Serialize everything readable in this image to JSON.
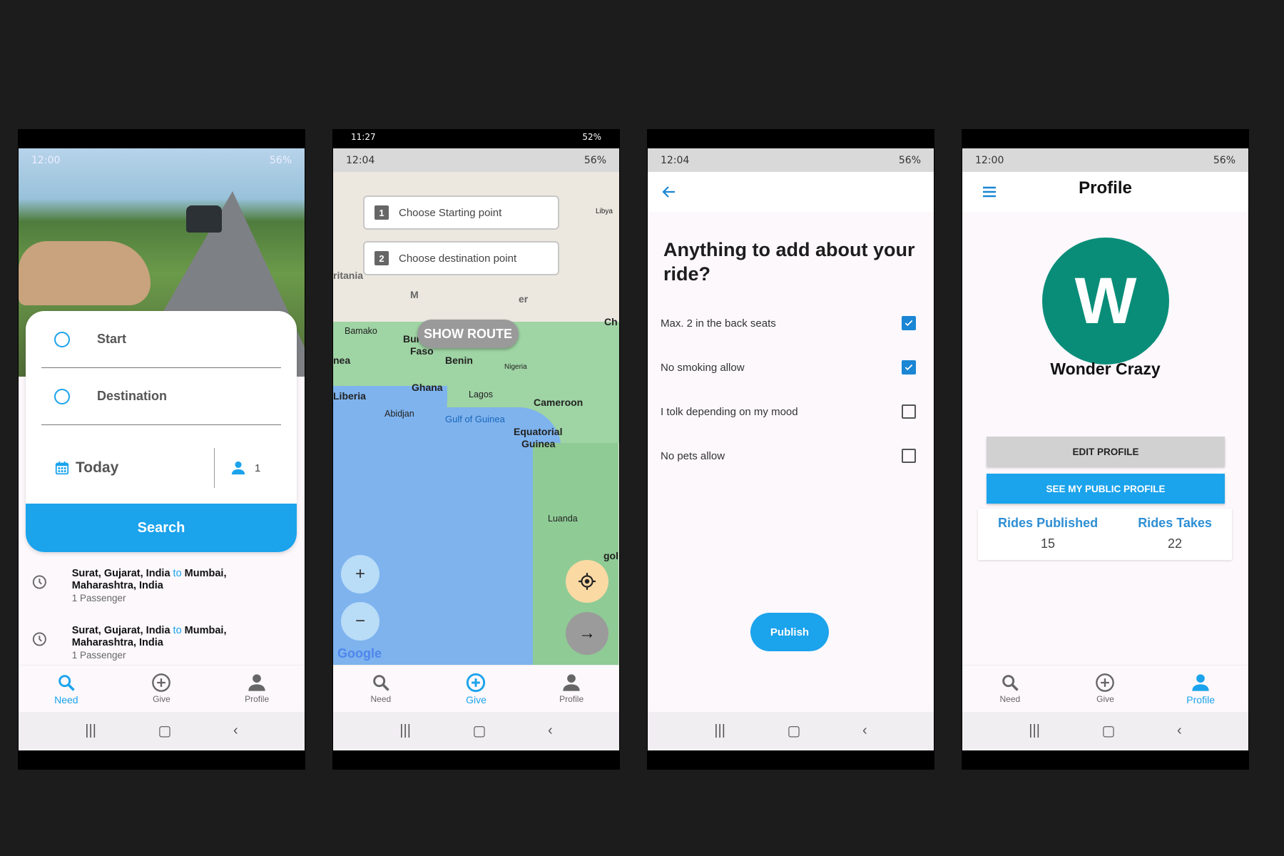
{
  "phone1": {
    "status_time": "12:00",
    "status_right": "56%",
    "start_label": "Start",
    "destination_label": "Destination",
    "date_label": "Today",
    "passenger_count": "1",
    "search_label": "Search",
    "recent": [
      {
        "from": "Surat, Gujarat, India",
        "to_word": "to",
        "to": "Mumbai, Maharashtra, India",
        "passengers": "1 Passenger"
      },
      {
        "from": "Surat, Gujarat, India",
        "to_word": "to",
        "to": "Mumbai, Maharashtra, India",
        "passengers": "1 Passenger"
      }
    ],
    "nav": [
      "Need",
      "Give",
      "Profile"
    ]
  },
  "phone2": {
    "outer_status_time": "11:27",
    "outer_status_right": "52%",
    "status_time": "12:04",
    "status_right": "56%",
    "start_field": "Choose Starting point",
    "start_num": "1",
    "dest_field": "Choose destination point",
    "dest_num": "2",
    "show_route": "SHOW ROUTE",
    "map_labels": {
      "libya": "Libya",
      "mauritania": "ritania",
      "mali": "M",
      "niger": "er",
      "chad": "Ch",
      "bamako": "Bamako",
      "burkina": "Burkina",
      "faso": "Faso",
      "guinea": "nea",
      "benin": "Benin",
      "nigeria": "Nigeria",
      "ghana": "Ghana",
      "liberia": "Liberia",
      "lagos": "Lagos",
      "cameroon": "Cameroon",
      "abidjan": "Abidjan",
      "gulf": "Gulf of Guinea",
      "eq1": "Equatorial",
      "eq2": "Guinea",
      "luanda": "Luanda",
      "angola": "gol",
      "google": "Google"
    },
    "nav": [
      "Need",
      "Give",
      "Profile"
    ]
  },
  "phone3": {
    "status_time": "12:04",
    "status_right": "56%",
    "title": "Anything to add about your ride?",
    "options": [
      {
        "label": "Max. 2 in the back seats",
        "checked": true
      },
      {
        "label": "No smoking allow",
        "checked": true
      },
      {
        "label": "I tolk depending on my mood",
        "checked": false
      },
      {
        "label": "No pets allow",
        "checked": false
      }
    ],
    "publish": "Publish"
  },
  "phone4": {
    "status_time": "12:00",
    "status_right": "56%",
    "title": "Profile",
    "avatar_letter": "W",
    "name": "Wonder Crazy",
    "edit_profile": "EDIT PROFILE",
    "public_profile": "SEE MY PUBLIC PROFILE",
    "rides_published_label": "Rides Published",
    "rides_published": "15",
    "rides_takes_label": "Rides Takes",
    "rides_takes": "22",
    "nav": [
      "Need",
      "Give",
      "Profile"
    ]
  },
  "colors": {
    "accent": "#1ba3ec",
    "avatar": "#098d78",
    "link": "#2e8fd4"
  }
}
